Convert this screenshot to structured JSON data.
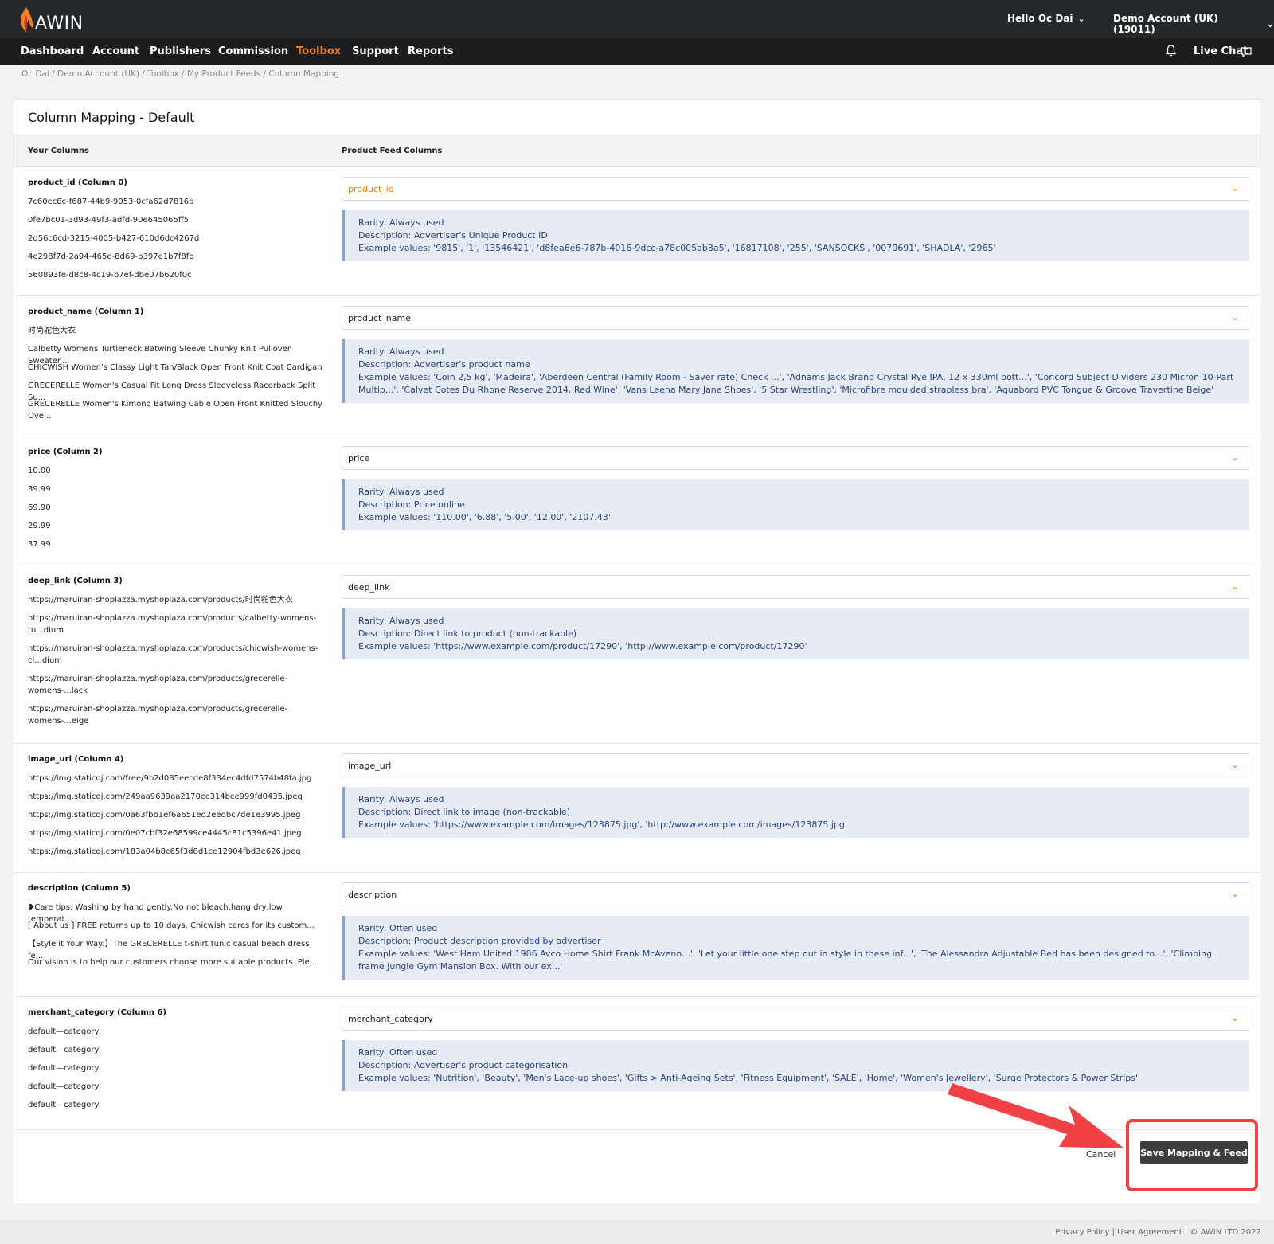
{
  "brand": {
    "logo_text": "AWIN"
  },
  "topbar": {
    "greeting": "Hello Oc Dai",
    "account": "Demo Account (UK) (19011)"
  },
  "nav": {
    "items": [
      "Dashboard",
      "Account",
      "Publishers",
      "Commission",
      "Toolbox",
      "Support",
      "Reports"
    ],
    "active": "Toolbox",
    "live_chat": "Live Chat"
  },
  "breadcrumb": "Oc Dai / Demo Account (UK) / Toolbox / My Product Feeds / Column Mapping",
  "page": {
    "title": "Column Mapping - Default",
    "col_your": "Your Columns",
    "col_feed": "Product Feed Columns"
  },
  "rows": [
    {
      "title": "product_id (Column 0)",
      "samples": [
        "7c60ec8c-f687-44b9-9053-0cfa62d7816b",
        "0fe7bc01-3d93-49f3-adfd-90e645065ff5",
        "2d56c6cd-3215-4005-b427-610d6dc4267d",
        "4e298f7d-2a94-465e-8d69-b397e1b7f8fb",
        "560893fe-d8c8-4c19-b7ef-dbe07b620f0c"
      ],
      "select": "product_id",
      "info": [
        "Rarity: Always used",
        "Description: Advertiser's Unique Product ID",
        "Example values: '9815', '1', '13546421', 'd8fea6e6-787b-4016-9dcc-a78c005ab3a5', '16817108', '255', 'SANSOCKS', '0070691', 'SHADLA', '2965'"
      ]
    },
    {
      "title": "product_name (Column 1)",
      "samples": [
        "时尚驼色大衣",
        "Calbetty Womens Turtleneck Batwing Sleeve Chunky Knit Pullover Sweater...",
        "CHICWISH Women's Classy Light Tan/Black Open Front Knit Coat Cardigan ...",
        "GRECERELLE Women's Casual Fit Long Dress Sleeveless Racerback Split Su...",
        "GRECERELLE Women's Kimono Batwing Cable Open Front Knitted Slouchy Ove..."
      ],
      "select": "product_name",
      "info": [
        "Rarity: Always used",
        "Description: Advertiser's product name",
        "Example values: 'Coin 2,5 kg', 'Madeira', 'Aberdeen Central (Family Room - Saver rate) Check ...', 'Adnams Jack Brand Crystal Rye IPA, 12 x 330ml bott...', 'Concord Subject Dividers 230 Micron 10-Part Multip...', 'Calvet Cotes Du Rhone Reserve 2014, Red Wine', 'Vans Leena Mary Jane Shoes', '5 Star Wrestling', 'Microfibre moulded strapless bra', 'Aquabord PVC Tongue & Groove Travertine Beige'"
      ]
    },
    {
      "title": "price (Column 2)",
      "samples": [
        "10.00",
        "39.99",
        "69.90",
        "29.99",
        "37.99"
      ],
      "select": "price",
      "info": [
        "Rarity: Always used",
        "Description: Price online",
        "Example values: '110.00', '6.88', '5.00', '12.00', '2107.43'"
      ]
    },
    {
      "title": "deep_link (Column 3)",
      "samples": [
        "https://maruiran-shoplazza.myshoplaza.com/products/时尚驼色大衣",
        "https://maruiran-shoplazza.myshoplaza.com/products/calbetty-womens-tu...dium",
        "https://maruiran-shoplazza.myshoplaza.com/products/chicwish-womens-cl...dium",
        "https://maruiran-shoplazza.myshoplaza.com/products/grecerelle-womens-...lack",
        "https://maruiran-shoplazza.myshoplaza.com/products/grecerelle-womens-...eige"
      ],
      "select": "deep_link",
      "info": [
        "Rarity: Always used",
        "Description: Direct link to product (non-trackable)",
        "Example values: 'https://www.example.com/product/17290', 'http://www.example.com/product/17290'"
      ]
    },
    {
      "title": "image_url (Column 4)",
      "samples": [
        "https://img.staticdj.com/free/9b2d085eecde8f334ec4dfd7574b48fa.jpg",
        "https://img.staticdj.com/249aa9639aa2170ec314bce999fd0435.jpeg",
        "https://img.staticdj.com/0a63fbb1ef6a651ed2eedbc7de1e3995.jpeg",
        "https://img.staticdj.com/0e07cbf32e68599ce4445c81c5396e41.jpeg",
        "https://img.staticdj.com/183a04b8c65f3d8d1ce12904fbd3e626.jpeg"
      ],
      "select": "image_url",
      "info": [
        "Rarity: Always used",
        "Description: Direct link to image (non-trackable)",
        "Example values: 'https://www.example.com/images/123875.jpg', 'http://www.example.com/images/123875.jpg'"
      ]
    },
    {
      "title": "description (Column 5)",
      "samples": [
        "❥Care tips: Washing by hand gently.No not bleach,hang dry,low temperat...",
        "[ About us ] FREE returns up to 10 days. Chicwish cares for its custom...",
        "【Style it Your Way:】The GRECERELLE t-shirt tunic casual beach dress fe...",
        "Our vision is to help our customers choose more suitable products. Ple..."
      ],
      "select": "description",
      "info": [
        "Rarity: Often used",
        "Description: Product description provided by advertiser",
        "Example values: 'West Ham United 1986 Avco Home Shirt Frank McAvenn...', 'Let your little one step out in style in these inf...', 'The Alessandra Adjustable Bed has been designed to...', 'Climbing frame Jungle Gym Mansion Box. With our ex...'"
      ]
    },
    {
      "title": "merchant_category (Column 6)",
      "samples": [
        "default—category",
        "default—category",
        "default—category",
        "default—category",
        "default—category"
      ],
      "select": "merchant_category",
      "info": [
        "Rarity: Often used",
        "Description: Advertiser's product categorisation",
        "Example values: 'Nutrition', 'Beauty', 'Men's Lace-up shoes', 'Gifts > Anti-Ageing Sets', 'Fitness Equipment', 'SALE', 'Home', 'Women's Jewellery', 'Surge Protectors & Power Strips'"
      ]
    }
  ],
  "actions": {
    "cancel": "Cancel",
    "save": "Save Mapping & Feed"
  },
  "footer": "Privacy Policy | User Agreement | © AWIN LTD 2022",
  "colors": {
    "accent": "#f28123",
    "info_bg": "#e7ebf4",
    "info_text": "#27457a",
    "highlight": "#f04245"
  }
}
